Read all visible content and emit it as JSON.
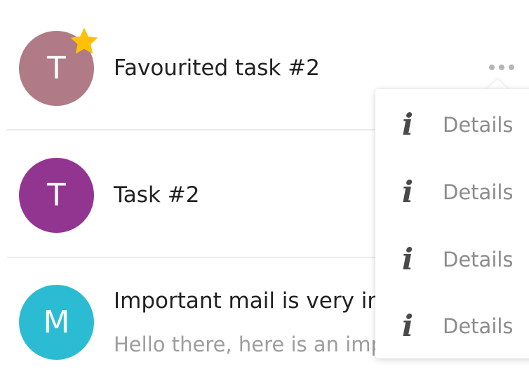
{
  "items": [
    {
      "avatar_letter": "T",
      "avatar_color": "#b07a86",
      "favourite": true,
      "title": "Favourited task #2"
    },
    {
      "avatar_letter": "T",
      "avatar_color": "#923591",
      "favourite": false,
      "title": "Task #2"
    },
    {
      "avatar_letter": "M",
      "avatar_color": "#2bbcd4",
      "favourite": false,
      "title": "Important mail is very important",
      "subtitle": "Hello there, here is an important mail"
    }
  ],
  "context_menu": {
    "items": [
      {
        "icon": "info-icon",
        "label": "Details"
      },
      {
        "icon": "info-icon",
        "label": "Details"
      },
      {
        "icon": "info-icon",
        "label": "Details"
      },
      {
        "icon": "info-icon",
        "label": "Details"
      }
    ]
  },
  "colors": {
    "star": "#ffc107",
    "divider": "#ececec",
    "title_text": "#212121",
    "secondary_text": "#9e9e9e"
  }
}
